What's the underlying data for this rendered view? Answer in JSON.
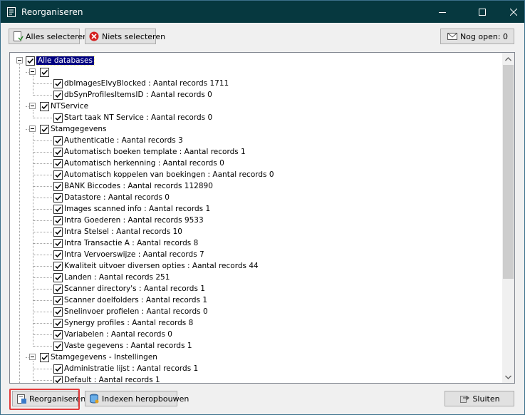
{
  "window": {
    "title": "Reorganiseren"
  },
  "toolbar": {
    "select_all_label": "Alles selecteren",
    "select_none_label": "Niets selecteren",
    "open_count_label": "Nog open: 0"
  },
  "tree": {
    "root": {
      "label": "Alle databases",
      "checked": true
    },
    "groups": [
      {
        "label": "",
        "checked": true,
        "items": [
          {
            "label": "dbImagesElvyBlocked : Aantal records 1711",
            "checked": true
          },
          {
            "label": "dbSynProfilesItemsID : Aantal records 0",
            "checked": true
          }
        ]
      },
      {
        "label": "NTService",
        "checked": true,
        "items": [
          {
            "label": "Start taak NT Service : Aantal records 0",
            "checked": true
          }
        ]
      },
      {
        "label": "Stamgegevens",
        "checked": true,
        "items": [
          {
            "label": "Authenticatie : Aantal records 3",
            "checked": true
          },
          {
            "label": "Automatisch boeken template : Aantal records 1",
            "checked": true
          },
          {
            "label": "Automatisch herkenning : Aantal records 0",
            "checked": true
          },
          {
            "label": "Automatisch koppelen van boekingen : Aantal records 0",
            "checked": true
          },
          {
            "label": "BANK Biccodes : Aantal records 112890",
            "checked": true
          },
          {
            "label": "Datastore : Aantal records 0",
            "checked": true
          },
          {
            "label": "Images scanned info : Aantal records 1",
            "checked": true
          },
          {
            "label": "Intra Goederen : Aantal records 9533",
            "checked": true
          },
          {
            "label": "Intra Stelsel : Aantal records 10",
            "checked": true
          },
          {
            "label": "Intra Transactie A : Aantal records 8",
            "checked": true
          },
          {
            "label": "Intra Vervoerswijze : Aantal records 7",
            "checked": true
          },
          {
            "label": "Kwaliteit uitvoer diversen opties : Aantal records 44",
            "checked": true
          },
          {
            "label": "Landen : Aantal records 251",
            "checked": true
          },
          {
            "label": "Scanner directory's : Aantal records 1",
            "checked": true
          },
          {
            "label": "Scanner doelfolders : Aantal records 1",
            "checked": true
          },
          {
            "label": "Snelinvoer profielen : Aantal records 0",
            "checked": true
          },
          {
            "label": "Synergy profiles : Aantal records 8",
            "checked": true
          },
          {
            "label": "Variabelen : Aantal records 0",
            "checked": true
          },
          {
            "label": "Vaste gegevens : Aantal records 1",
            "checked": true
          }
        ]
      },
      {
        "label": "Stamgegevens - Instellingen",
        "checked": true,
        "items": [
          {
            "label": "Administratie lijst : Aantal records 1",
            "checked": true
          },
          {
            "label": "Default : Aantal records 1",
            "checked": true
          }
        ]
      }
    ]
  },
  "footer": {
    "reorganize_label": "Reorganiseren",
    "rebuild_indexes_label": "Indexen heropbouwen",
    "close_label": "Sluiten"
  },
  "colors": {
    "titlebar": "#06383f",
    "selection": "#000080",
    "highlight_border": "#e23c3c"
  }
}
